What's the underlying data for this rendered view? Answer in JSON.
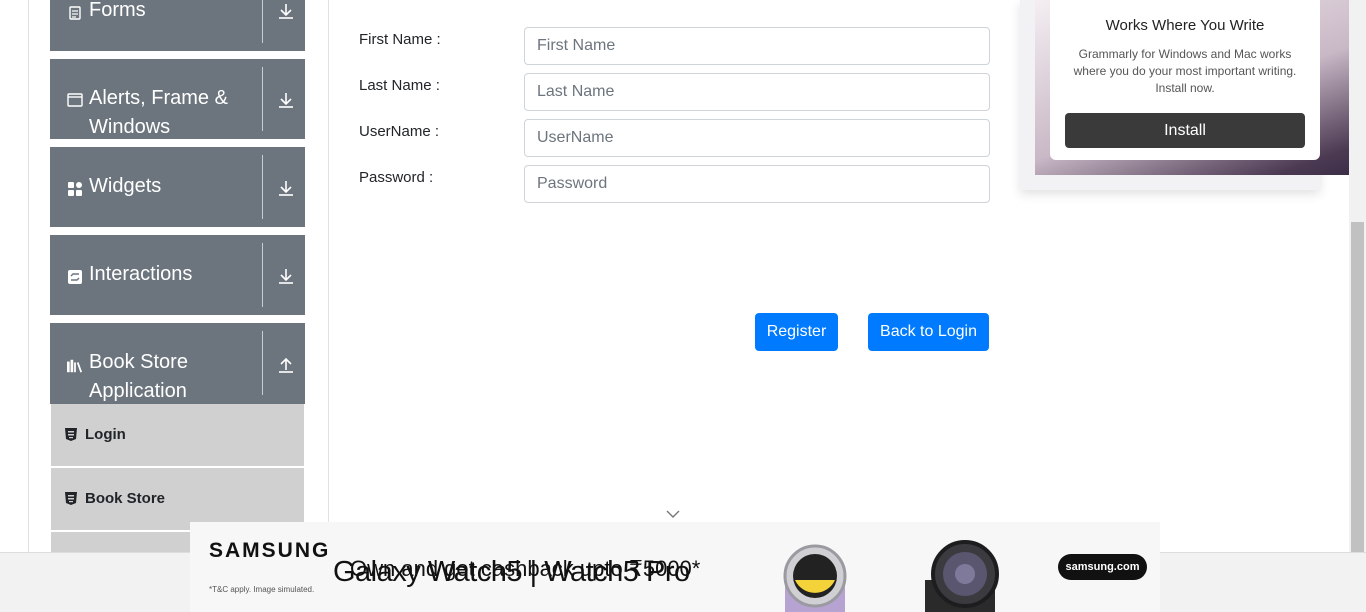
{
  "sidebar": {
    "groups": [
      {
        "title": "Forms",
        "icon": "form-icon",
        "toggle": "expand-arrow-icon"
      },
      {
        "title": "Alerts, Frame & Windows",
        "icon": "window-icon",
        "toggle": "expand-arrow-icon"
      },
      {
        "title": "Widgets",
        "icon": "widgets-icon",
        "toggle": "expand-arrow-icon"
      },
      {
        "title": "Interactions",
        "icon": "interactions-icon",
        "toggle": "expand-arrow-icon"
      },
      {
        "title": "Book Store Application",
        "icon": "book-store-icon",
        "toggle": "collapse-arrow-icon"
      }
    ],
    "items": [
      {
        "label": "Login",
        "icon": "html5-icon"
      },
      {
        "label": "Book Store",
        "icon": "html5-icon"
      }
    ]
  },
  "form": {
    "first_name": {
      "label": "First Name :",
      "placeholder": "First Name",
      "value": ""
    },
    "last_name": {
      "label": "Last Name :",
      "placeholder": "Last Name",
      "value": ""
    },
    "username": {
      "label": "UserName :",
      "placeholder": "UserName",
      "value": ""
    },
    "password": {
      "label": "Password :",
      "placeholder": "Password",
      "value": ""
    },
    "register_label": "Register",
    "back_label": "Back to Login"
  },
  "grammarly_ad": {
    "title": "Works Where You Write",
    "text": "Grammarly for Windows and Mac works where you do your most important writing. Install now.",
    "button": "Install"
  },
  "samsung_ad": {
    "brand": "SAMSUNG",
    "fine_print": "*T&C apply. Image simulated.",
    "promo": "Own and get cashback upto ₹5000*",
    "headline": "Galaxy Watch5 | Watch5 Pro",
    "url": "samsung.com"
  },
  "colors": {
    "sidebar_group_bg": "#6c757d",
    "menu_item_bg": "#d0d0d0",
    "primary_button": "#007bff"
  }
}
